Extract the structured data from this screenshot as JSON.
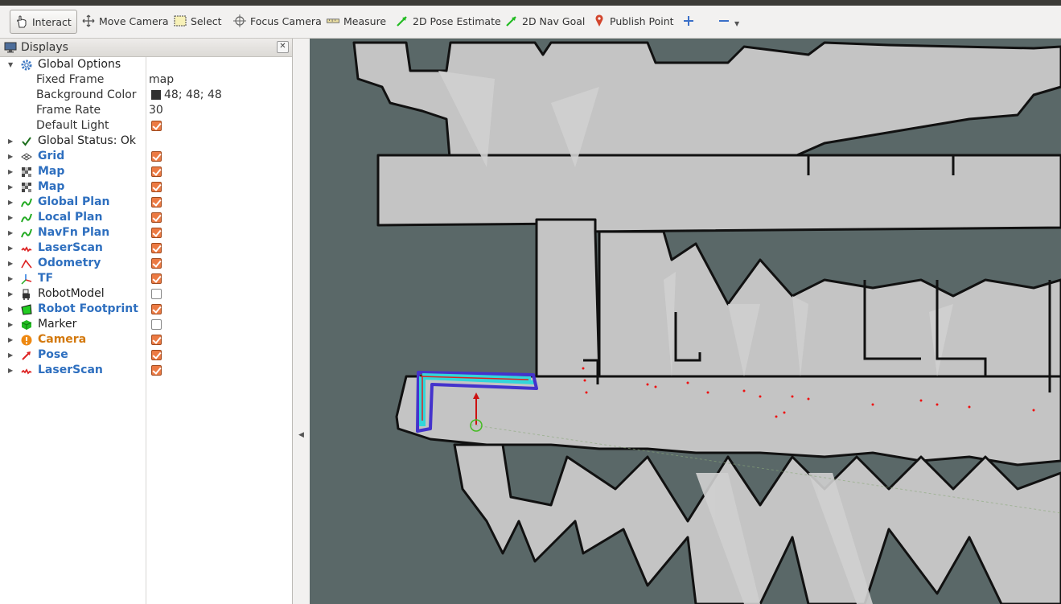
{
  "toolbar": {
    "tools": [
      {
        "label": "Interact",
        "icon": "hand-pointer-icon"
      },
      {
        "label": "Move Camera",
        "icon": "move-arrows-icon"
      },
      {
        "label": "Select",
        "icon": "selection-box-icon"
      },
      {
        "label": "Focus Camera",
        "icon": "crosshair-icon"
      },
      {
        "label": "Measure",
        "icon": "ruler-icon"
      },
      {
        "label": "2D Pose Estimate",
        "icon": "green-arrow-icon"
      },
      {
        "label": "2D Nav Goal",
        "icon": "green-arrow-icon"
      },
      {
        "label": "Publish Point",
        "icon": "map-pin-icon"
      }
    ]
  },
  "displays": {
    "title": "Displays",
    "global_options": {
      "label": "Global Options",
      "fixed_frame_label": "Fixed Frame",
      "fixed_frame_value": "map",
      "background_color_label": "Background Color",
      "background_color_value": "48; 48; 48",
      "frame_rate_label": "Frame Rate",
      "frame_rate_value": "30",
      "default_light_label": "Default Light"
    },
    "global_status": "Global Status: Ok",
    "items": [
      {
        "label": "Grid",
        "checked": true,
        "icon": "grid-icon"
      },
      {
        "label": "Map",
        "checked": true,
        "icon": "map-icon"
      },
      {
        "label": "Map",
        "checked": true,
        "icon": "map-icon"
      },
      {
        "label": "Global Plan",
        "checked": true,
        "icon": "path-icon"
      },
      {
        "label": "Local Plan",
        "checked": true,
        "icon": "path-icon"
      },
      {
        "label": "NavFn Plan",
        "checked": true,
        "icon": "path-icon"
      },
      {
        "label": "LaserScan",
        "checked": true,
        "icon": "laser-scan-icon"
      },
      {
        "label": "Odometry",
        "checked": true,
        "icon": "odometry-icon"
      },
      {
        "label": "TF",
        "checked": true,
        "icon": "tf-axes-icon"
      },
      {
        "label": "RobotModel",
        "checked": false,
        "icon": "robot-model-icon"
      },
      {
        "label": "Robot Footprint",
        "checked": true,
        "icon": "polygon-icon"
      },
      {
        "label": "Marker",
        "checked": false,
        "icon": "marker-cube-icon"
      },
      {
        "label": "Camera",
        "checked": true,
        "icon": "warning-icon"
      },
      {
        "label": "Pose",
        "checked": true,
        "icon": "pose-arrow-icon"
      },
      {
        "label": "LaserScan",
        "checked": true,
        "icon": "laser-scan-icon"
      }
    ]
  },
  "colors": {
    "accent_blue": "#2e6fbf",
    "warning_orange": "#d3790e",
    "checkbox_orange": "#ec7a43",
    "map_unknown": "#5a6868",
    "map_free": "#c4c4c4",
    "map_wall": "#000000",
    "plan_cyan": "#33d6d9",
    "plan_blue": "#4433cc",
    "laser_red": "#ee1111"
  }
}
